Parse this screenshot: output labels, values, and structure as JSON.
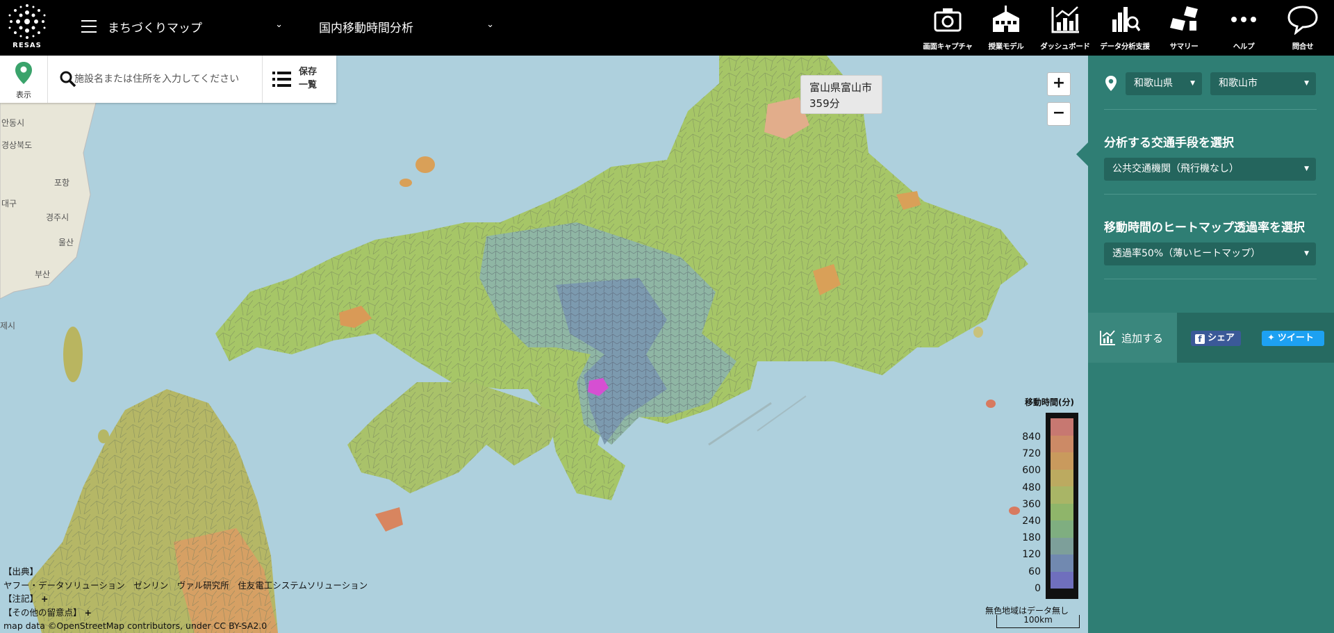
{
  "topbar": {
    "logo_text": "RESAS",
    "menu_label": "まちづくりマップ",
    "analysis_label": "国内移動時間分析",
    "icons": [
      {
        "name": "camera-icon",
        "label": "画面キャプチャ"
      },
      {
        "name": "school-icon",
        "label": "授業モデル"
      },
      {
        "name": "dashboard-icon",
        "label": "ダッシュボード"
      },
      {
        "name": "data-analysis-icon",
        "label": "データ分析支援"
      },
      {
        "name": "summary-icon",
        "label": "サマリー"
      },
      {
        "name": "more-icon",
        "label": "ヘルプ"
      },
      {
        "name": "chat-bubble-icon",
        "label": "問合せ"
      }
    ]
  },
  "search": {
    "display_label": "表示",
    "placeholder": "施設名または住所を入力してください",
    "value": "",
    "saved_label_1": "保存",
    "saved_label_2": "一覧"
  },
  "map": {
    "zoom_in": "+",
    "zoom_out": "−",
    "tooltip": {
      "place": "富山県富山市",
      "time": "359分"
    },
    "foreign_labels": [
      "안동시",
      "경상북도",
      "포항",
      "경주시",
      "대구",
      "울산",
      "부산",
      "제시"
    ],
    "credits": {
      "source_heading": "【出典】",
      "source_text": "ヤフー・データソリューション　ゼンリン　ヴァル研究所　住友電工システムソリューション",
      "note": "【注記】",
      "other_notes": "【その他の留意点】",
      "plus": "+",
      "osm": "map data ©OpenStreetMap contributors, under CC BY-SA2.0"
    },
    "legend": {
      "title": "移動時間(分)",
      "labels": [
        "840",
        "720",
        "600",
        "480",
        "360",
        "240",
        "180",
        "120",
        "60",
        "0"
      ],
      "colors": [
        "#c77871",
        "#cc8a66",
        "#c99a5d",
        "#bcaa60",
        "#a9b566",
        "#8fb56a",
        "#7fae80",
        "#7d9f9a",
        "#7189b0",
        "#6f6fbd"
      ],
      "no_data": "無色地域はデータ無し",
      "scale": "100km"
    }
  },
  "panel": {
    "prefecture": "和歌山県",
    "city": "和歌山市",
    "transport_heading": "分析する交通手段を選択",
    "transport_value": "公共交通機関（飛行機なし）",
    "heatmap_heading": "移動時間のヒートマップ透過率を選択",
    "heatmap_value": "透過率50%（薄いヒートマップ）",
    "add_label": "追加する",
    "share_label": "シェア",
    "tweet_label": "ツイート",
    "share_color": "#3b5998",
    "tweet_color": "#1da1f2"
  }
}
